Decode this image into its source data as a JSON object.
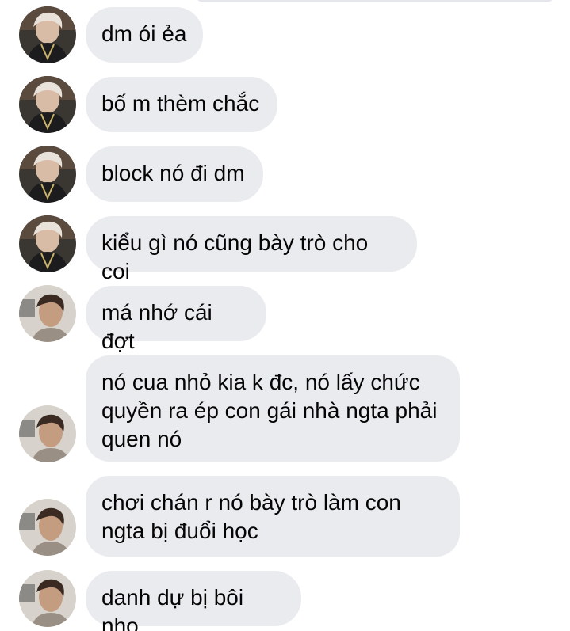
{
  "conversation": {
    "messages": [
      {
        "sender_avatar": "avatar-a",
        "text": "dm ói ẻa"
      },
      {
        "sender_avatar": "avatar-a",
        "text": "bố m thèm chắc"
      },
      {
        "sender_avatar": "avatar-a",
        "text": "block nó đi dm"
      },
      {
        "sender_avatar": "avatar-a",
        "text": "kiểu gì nó cũng bày trò cho coi"
      },
      {
        "sender_avatar": "avatar-b",
        "text": "má nhớ cái đợt"
      },
      {
        "sender_avatar": "avatar-b",
        "text": "nó cua nhỏ kia k đc, nó lấy chức\nquyền ra ép con gái nhà ngta phải\nquen nó"
      },
      {
        "sender_avatar": "avatar-b",
        "text": "chơi chán r nó bày trò làm con\nngta bị đuổi học"
      },
      {
        "sender_avatar": "avatar-b",
        "text": "danh dự bị bôi nhọ"
      }
    ]
  },
  "colors": {
    "bubble": "#e9ebee",
    "text": "#050505",
    "background": "#ffffff"
  }
}
